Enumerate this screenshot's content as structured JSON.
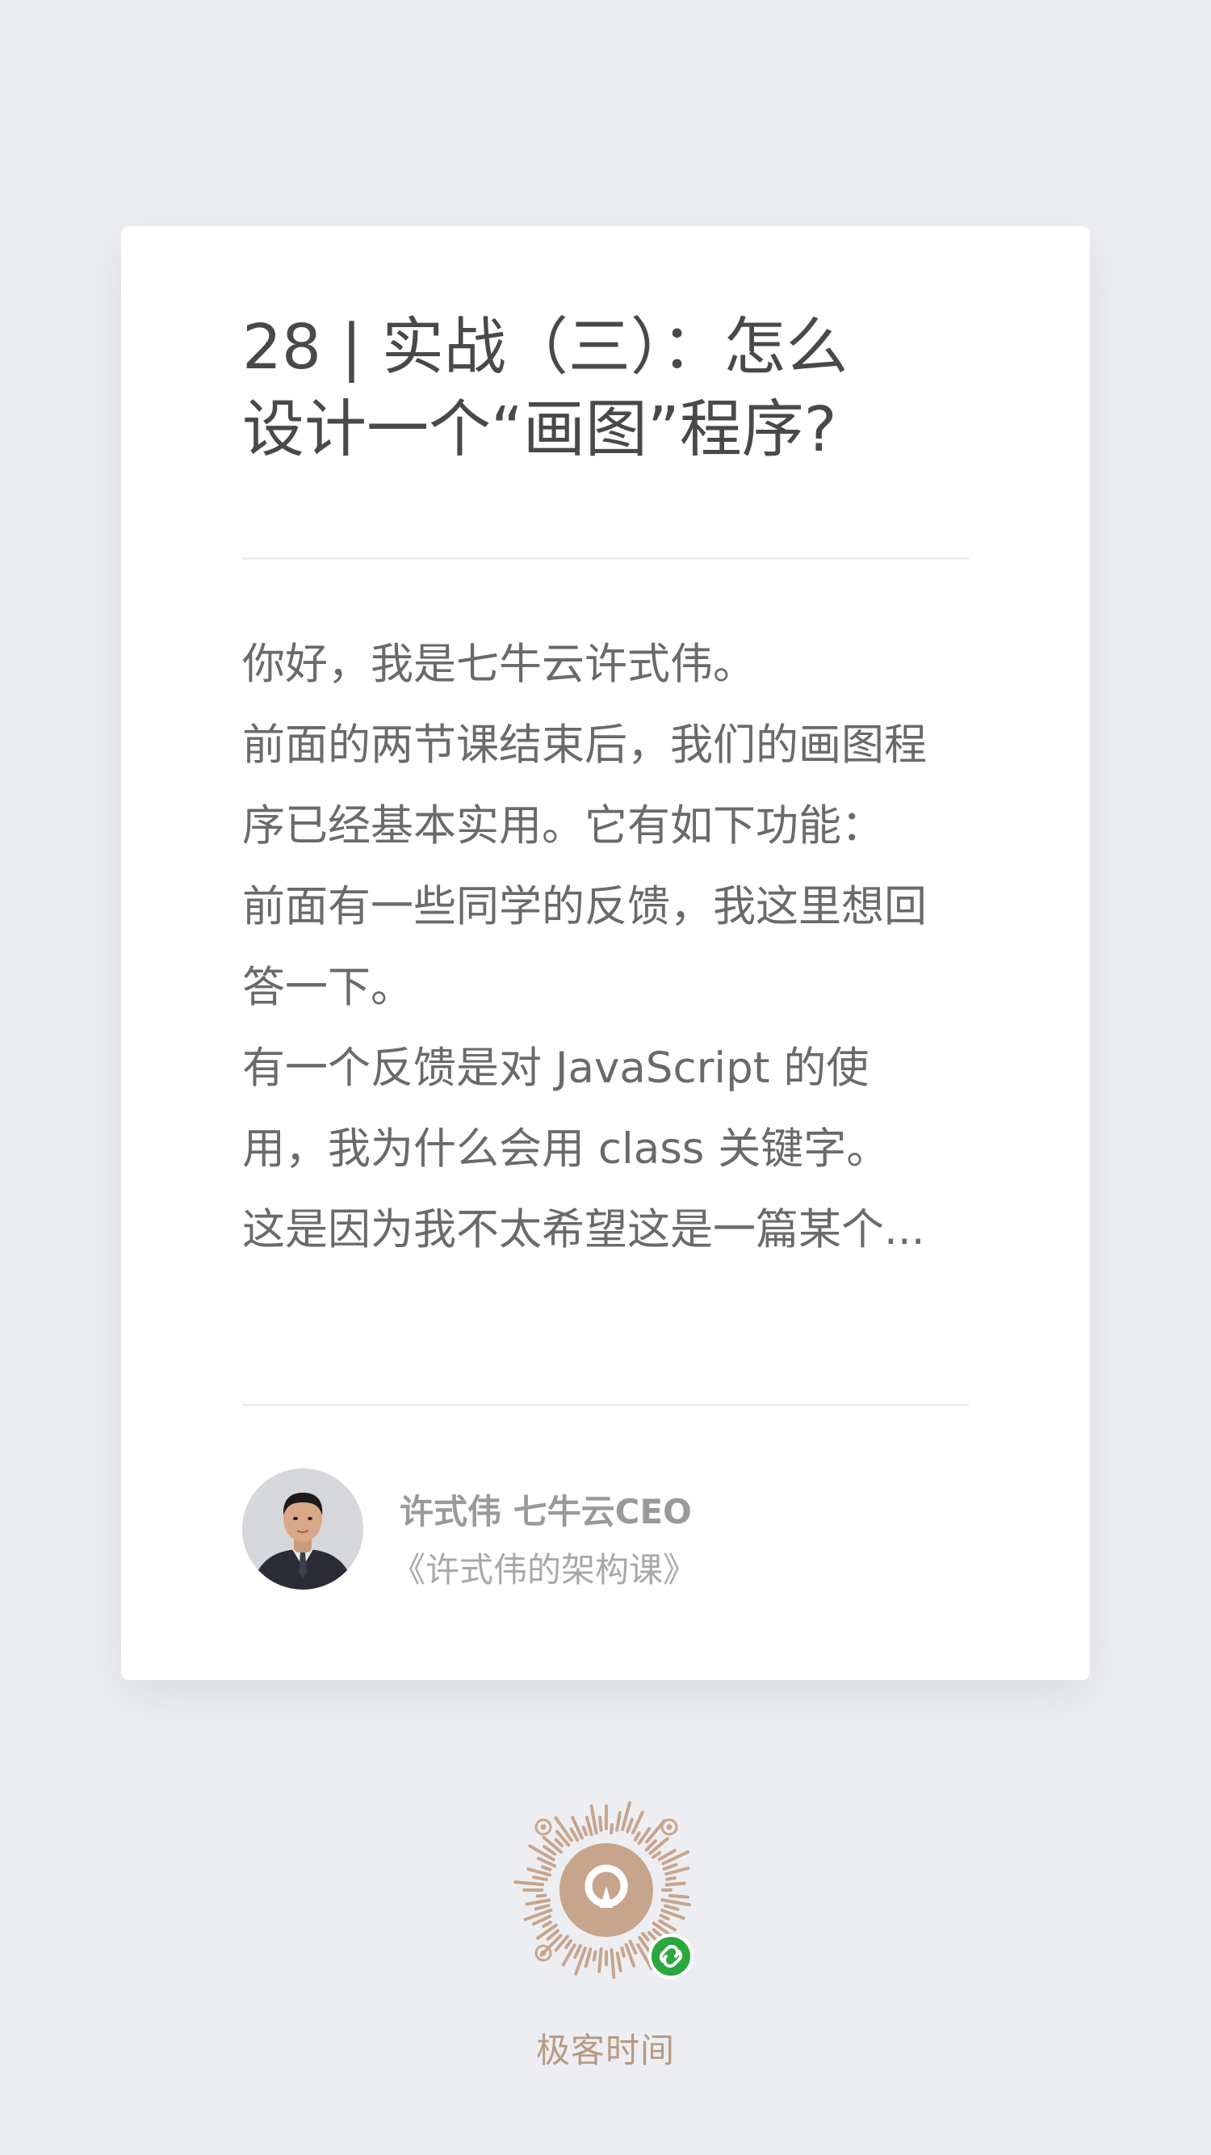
{
  "article": {
    "title_line1": "28 | 实战（三）：怎么",
    "title_line2": "设计一个“画图”程序?",
    "excerpt_lines": [
      "你好，我是七牛云许式伟。",
      "前面的两节课结束后，我们的画图程",
      "序已经基本实用。它有如下功能：",
      "前面有一些同学的反馈，我这里想回",
      "答一下。",
      "有一个反馈是对 JavaScript 的使",
      "用，我为什么会用 class 关键字。",
      "这是因为我不太希望这是一篇某个..."
    ]
  },
  "author": {
    "name": "许式伟 七牛云CEO",
    "course": "《许式伟的架构课》"
  },
  "footer": {
    "brand": "极客时间",
    "qr_icon": "mini-program-code-icon",
    "badge_icon": "mini-program-link-icon"
  },
  "colors": {
    "background": "#eceef2",
    "card": "#ffffff",
    "title": "#4b4848",
    "body": "#6a6a6a",
    "brand": "#b79a82",
    "badge": "#2aa83e"
  }
}
